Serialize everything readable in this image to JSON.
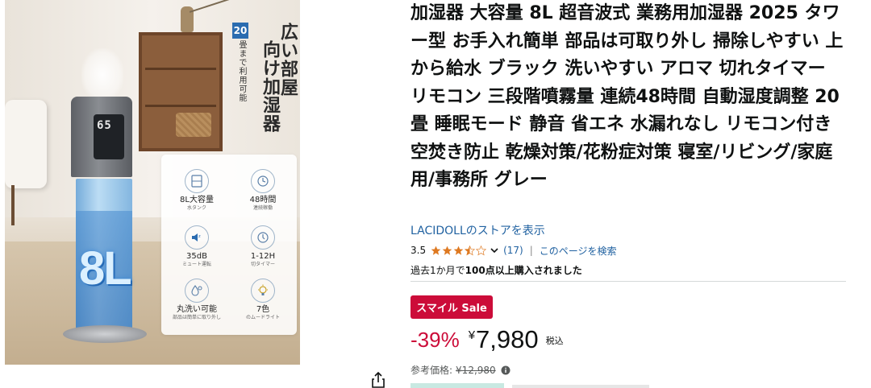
{
  "product_image": {
    "display_reading": "65",
    "capacity_badge": "8L",
    "headline_a": "広い部屋",
    "headline_b": "向け加湿器",
    "headline_number": "20",
    "headline_sub": "畳まで利用可能",
    "features": [
      {
        "icon": "tank-icon",
        "title": "8L大容量",
        "sub": "水タンク"
      },
      {
        "icon": "clock-icon",
        "title": "48時間",
        "sub": "連続稼働"
      },
      {
        "icon": "quiet-icon",
        "title": "35dB",
        "sub": "ミュート運転"
      },
      {
        "icon": "timer-icon",
        "title": "1-12H",
        "sub": "切タイマー"
      },
      {
        "icon": "droplets-icon",
        "title": "丸洗い可能",
        "sub": "部品は簡単に取り外し"
      },
      {
        "icon": "bulb-icon",
        "title": "7色",
        "sub": "のムードライト"
      }
    ]
  },
  "product": {
    "title": "加湿器 大容量 8L 超音波式 業務用加湿器 2025 タワー型 お手入れ簡単 部品は可取り外し 掃除しやすい 上から給水 ブラック 洗いやすい アロマ 切れタイマー リモコン 三段階噴霧量 連続48時間 自動湿度調整 20畳 睡眠モード 静音 省エネ 水漏れなし リモコン付き 空焚き防止 乾燥対策/花粉症対策 寝室/リビング/家庭用/事務所 グレー",
    "store_link": "LACIDOLLのストアを表示",
    "rating_value": "3.5",
    "rating_stars": 3.5,
    "rating_count": "(17)",
    "divider": "|",
    "search_link": "このページを検索",
    "bought_prefix": "過去1か月で",
    "bought_bold": "100点以上購入されました",
    "sale_badge": "スマイル Sale",
    "discount": "-39%",
    "currency": "¥",
    "price": "7,980",
    "tax": "税込",
    "ref_label": "参考価格:",
    "ref_price": "¥12,980"
  },
  "colors": {
    "link": "#2162a1",
    "sale_red": "#cc0c39",
    "star": "#de7921",
    "text": "#0f1111",
    "muted": "#565959"
  },
  "icons": {
    "share": "share-icon",
    "chevron": "chevron-down-icon",
    "info": "info-icon",
    "star": "star-icon"
  }
}
